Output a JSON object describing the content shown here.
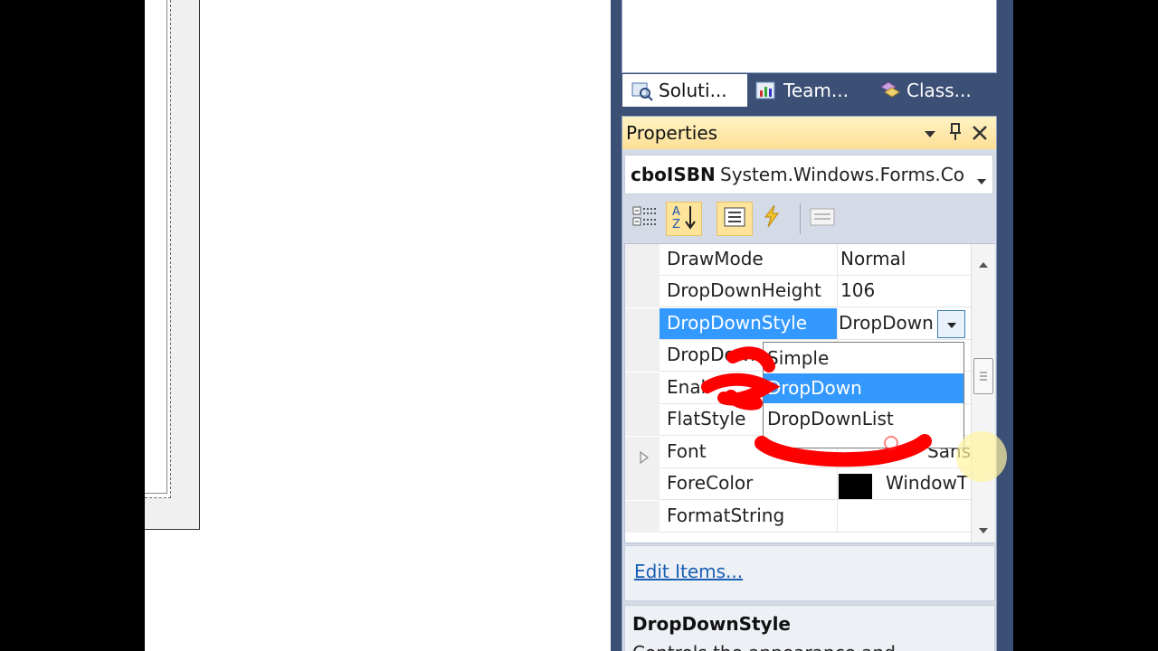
{
  "tabs": [
    {
      "label": "Soluti...",
      "icon": "solution-explorer-icon"
    },
    {
      "label": "Team...",
      "icon": "team-explorer-icon"
    },
    {
      "label": "Class...",
      "icon": "class-view-icon"
    }
  ],
  "properties": {
    "title": "Properties",
    "object_name": "cboISBN",
    "object_type": "System.Windows.Forms.Co",
    "rows": [
      {
        "name": "DrawMode",
        "value": "Normal"
      },
      {
        "name": "DropDownHeight",
        "value": "106"
      },
      {
        "name": "DropDownStyle",
        "value": "DropDown"
      },
      {
        "name": "DropDown",
        "value": ""
      },
      {
        "name": "Enab",
        "value": ""
      },
      {
        "name": "FlatStyle",
        "value": ""
      },
      {
        "name": "Font",
        "value": "Sans"
      },
      {
        "name": "ForeColor",
        "value": "WindowT"
      },
      {
        "name": "FormatString",
        "value": ""
      }
    ],
    "dropdown_options": [
      "Simple",
      "DropDown",
      "DropDownList"
    ],
    "selected_option": "DropDown",
    "command_link": "Edit Items...",
    "desc_title": "DropDownStyle",
    "desc_text": "Controls the appearance and",
    "forecolor_swatch": "#000000"
  },
  "colors": {
    "accent": "#3399ff",
    "annotation": "#ff0000",
    "title_bar": "#fde49a",
    "pane_bg": "#3c4f75"
  }
}
